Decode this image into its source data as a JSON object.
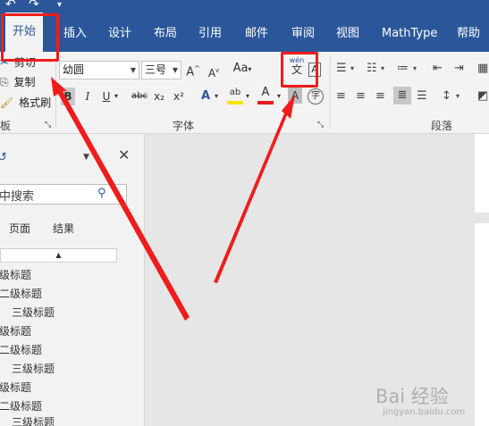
{
  "ribbon_tabs": {
    "home": "开始",
    "insert": "插入",
    "design": "设计",
    "layout": "布局",
    "references": "引用",
    "mailings": "邮件",
    "review": "审阅",
    "view": "视图",
    "mathtype": "MathType",
    "help": "帮助"
  },
  "clipboard": {
    "cut": "剪切",
    "copy": "复制",
    "format_painter": "格式刷",
    "group_label": "板"
  },
  "font": {
    "font_name": "幼圆",
    "font_size": "三号",
    "grow_label": "A",
    "shrink_label": "A",
    "change_case_label": "Aa",
    "phonetic_top": "wén",
    "phonetic_bottom": "文",
    "bold": "B",
    "italic": "I",
    "underline": "U",
    "strikethrough": "abc",
    "subscript": "x₂",
    "superscript": "x²",
    "effects": "A",
    "highlight": "ab",
    "font_color": "A",
    "char_shading": "A",
    "enclose": "字",
    "group_label": "字体"
  },
  "paragraph": {
    "group_label": "段落"
  },
  "nav": {
    "search_placeholder": "中搜索",
    "tab_pages": "页面",
    "tab_results": "结果",
    "collapse": "▲",
    "headings": [
      {
        "text": "级标题",
        "level": 1
      },
      {
        "text": "二级标题",
        "level": 2
      },
      {
        "text": "三级标题",
        "level": 3
      },
      {
        "text": "级标题",
        "level": 1
      },
      {
        "text": "二级标题",
        "level": 2
      },
      {
        "text": "三级标题",
        "level": 3
      },
      {
        "text": "级标题",
        "level": 1
      },
      {
        "text": "二级标题",
        "level": 2
      },
      {
        "text": "三级标题",
        "level": 3
      }
    ]
  },
  "watermark": {
    "main": "Bai 经验",
    "sub": "jingyan.baidu.com"
  },
  "colors": {
    "ribbon_blue": "#2b579a",
    "highlight_red": "#f01c1c",
    "highlight_yellow": "#f7e600"
  }
}
